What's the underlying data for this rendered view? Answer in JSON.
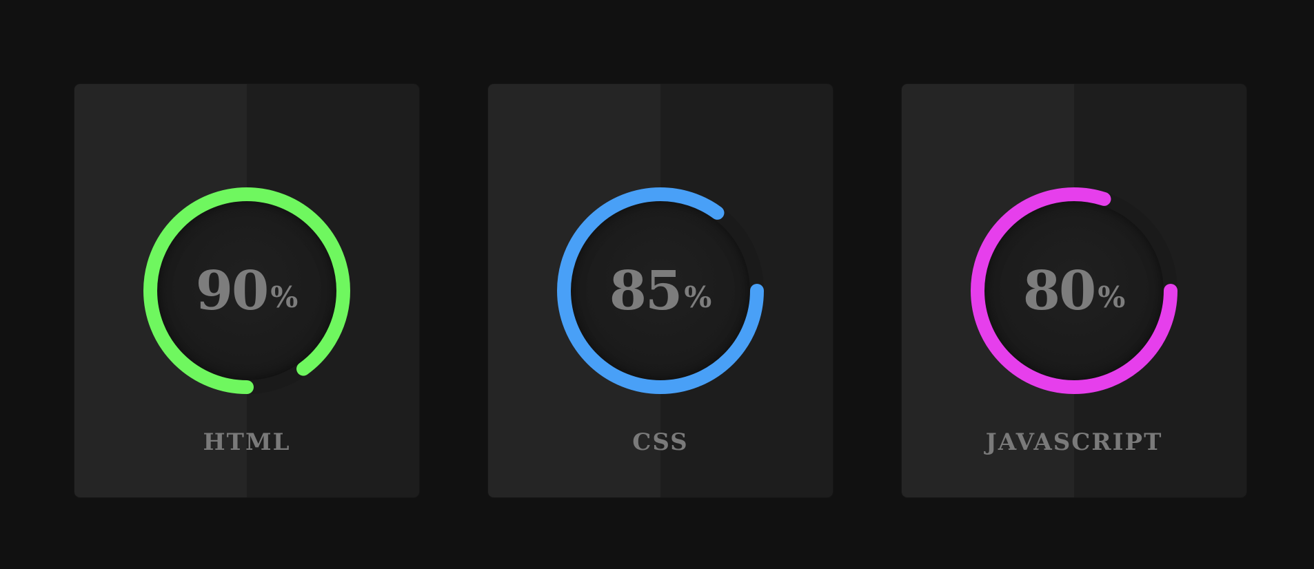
{
  "skills": [
    {
      "name": "HTML",
      "percent": 90,
      "percent_text": "90",
      "sign": "%",
      "color": "#6ff75f"
    },
    {
      "name": "CSS",
      "percent": 85,
      "percent_text": "85",
      "sign": "%",
      "color": "#49a0f7"
    },
    {
      "name": "JAVASCRIPT",
      "percent": 80,
      "percent_text": "80",
      "sign": "%",
      "color": "#e63fec"
    }
  ],
  "colors": {
    "background": "#111111",
    "card_left": "#252525",
    "card_right": "#1d1d1d",
    "text": "#7d7d7d",
    "track": "#1a1a1a"
  }
}
